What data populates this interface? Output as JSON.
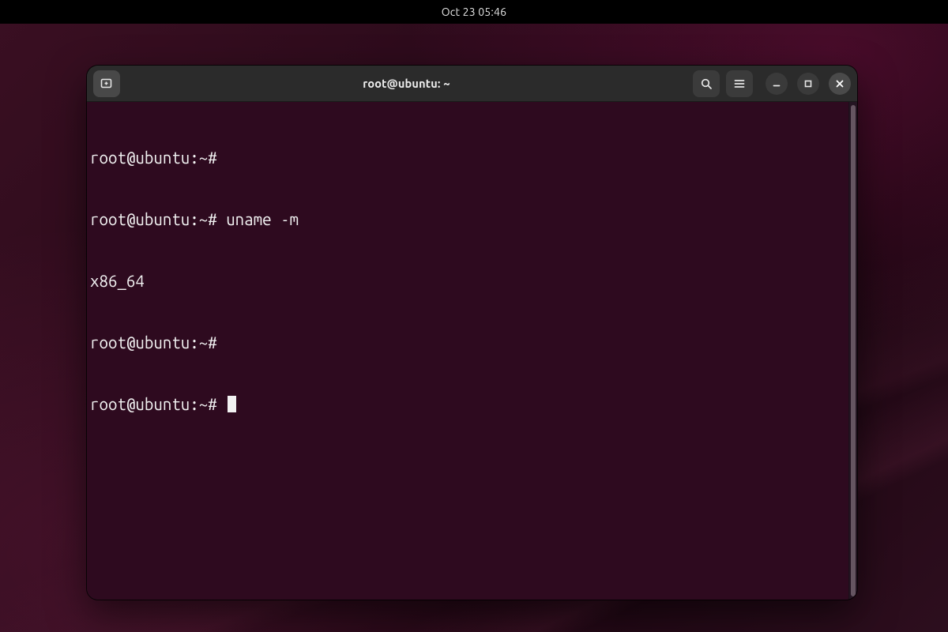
{
  "topbar": {
    "clock": "Oct 23  05:46"
  },
  "window": {
    "title": "root@ubuntu: ~"
  },
  "terminal": {
    "prompt": "root@ubuntu:~#",
    "lines": [
      "root@ubuntu:~# ",
      "root@ubuntu:~# uname -m",
      "x86_64",
      "root@ubuntu:~# ",
      "root@ubuntu:~# "
    ]
  },
  "icons": {
    "new_tab": "new-tab-icon",
    "search": "search-icon",
    "menu": "hamburger-menu-icon",
    "minimize": "minimize-icon",
    "maximize": "maximize-icon",
    "close": "close-icon"
  }
}
